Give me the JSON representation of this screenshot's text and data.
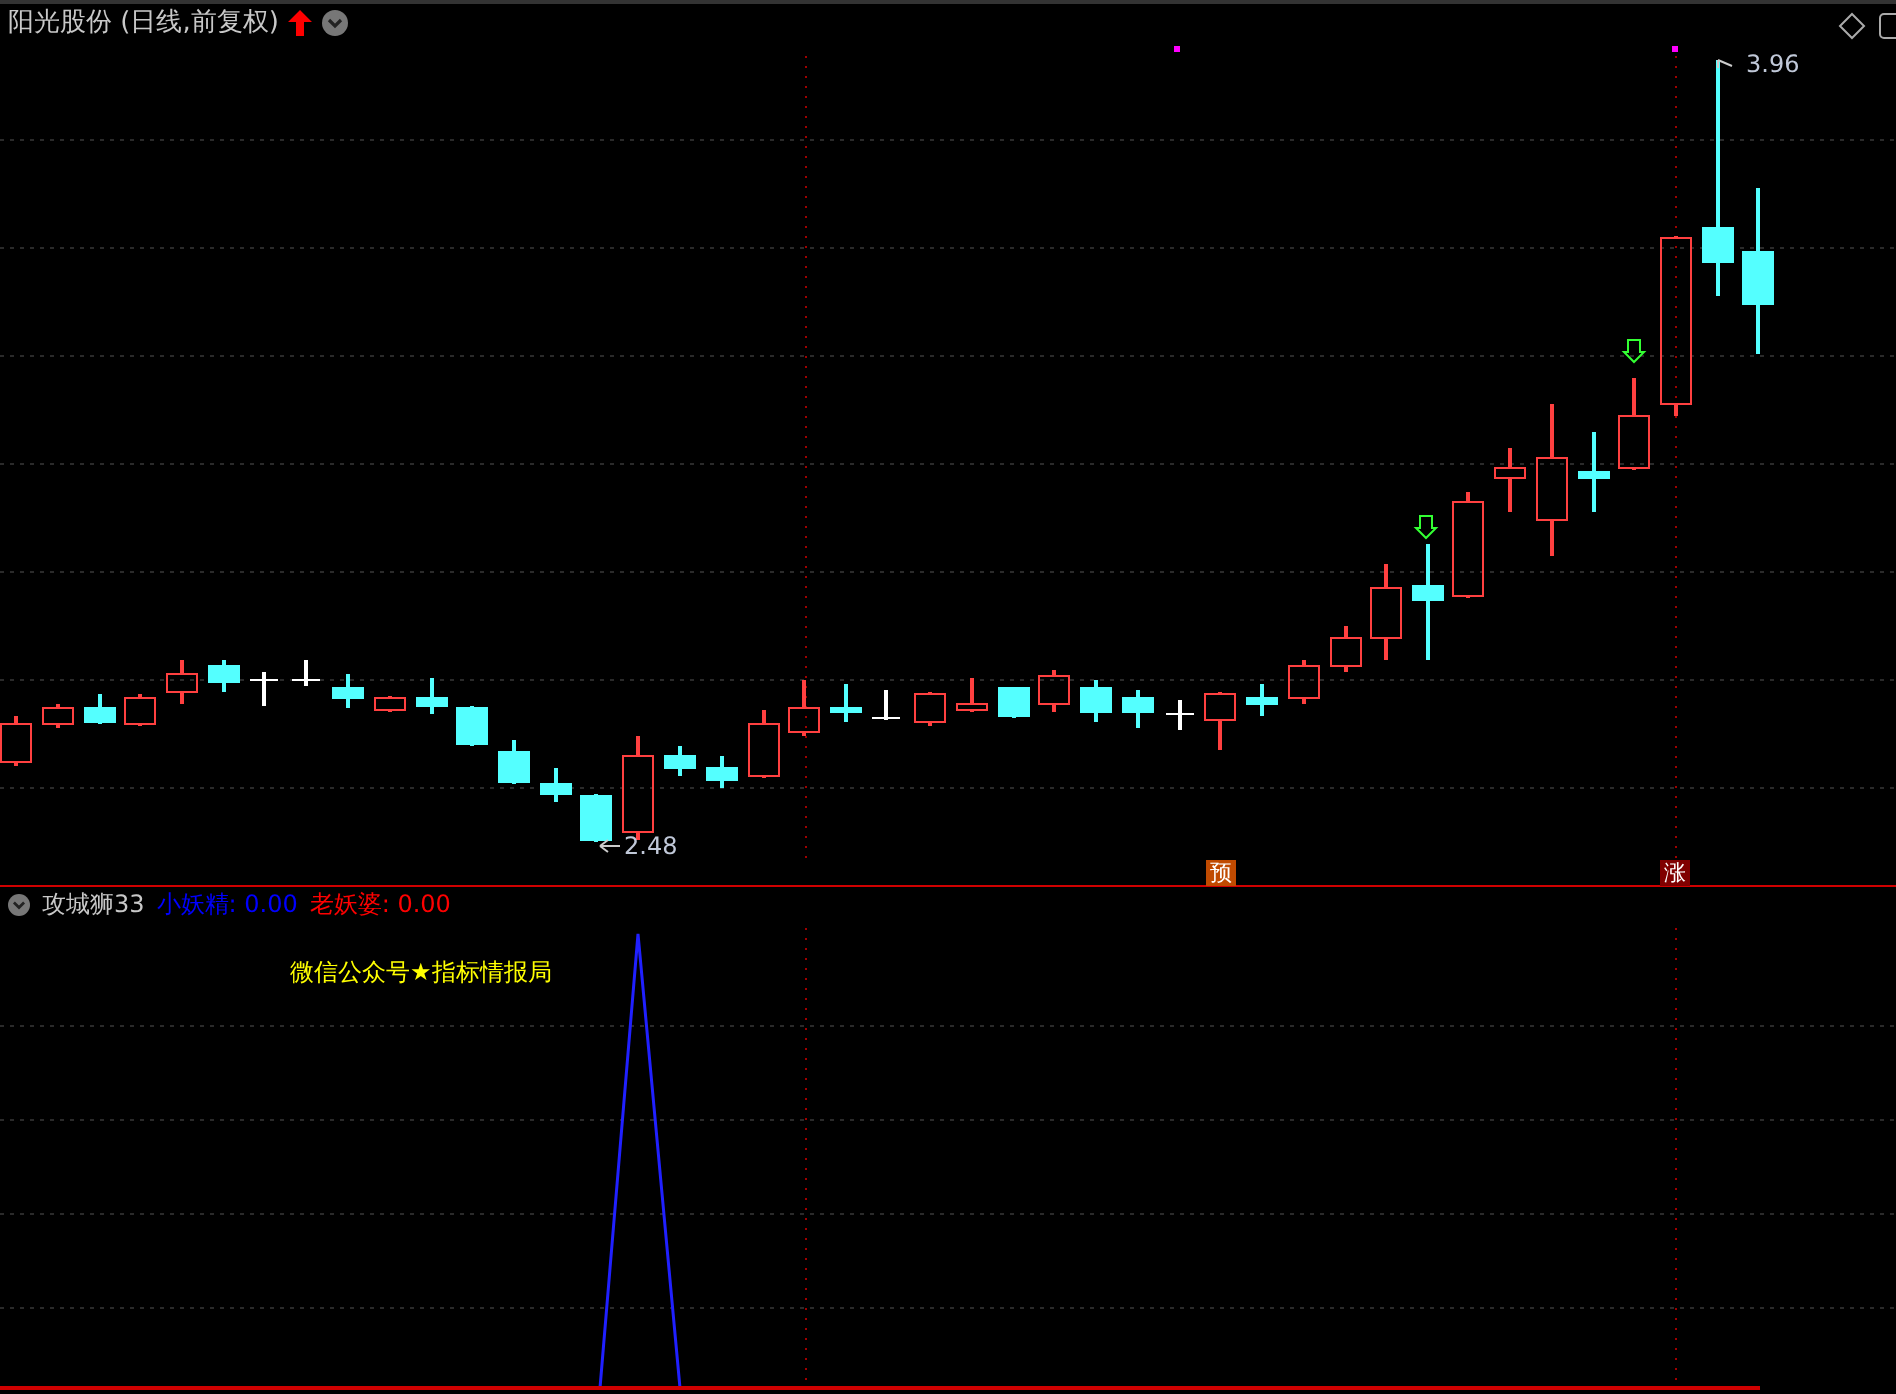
{
  "price_panel": {
    "title": "阳光股份 (日线,前复权)",
    "high_label": "3.96",
    "low_label": "2.48",
    "signals": [
      {
        "text": "预",
        "kind": "forecast"
      },
      {
        "text": "涨",
        "kind": "rise"
      }
    ]
  },
  "indicator_panel": {
    "name": "攻城狮33",
    "legend": [
      {
        "text": "小妖精: 0.00",
        "color": "#0000ff"
      },
      {
        "text": "老妖婆: 0.00",
        "color": "#ff0000"
      }
    ],
    "caption": "微信公众号★指标情报局"
  }
}
